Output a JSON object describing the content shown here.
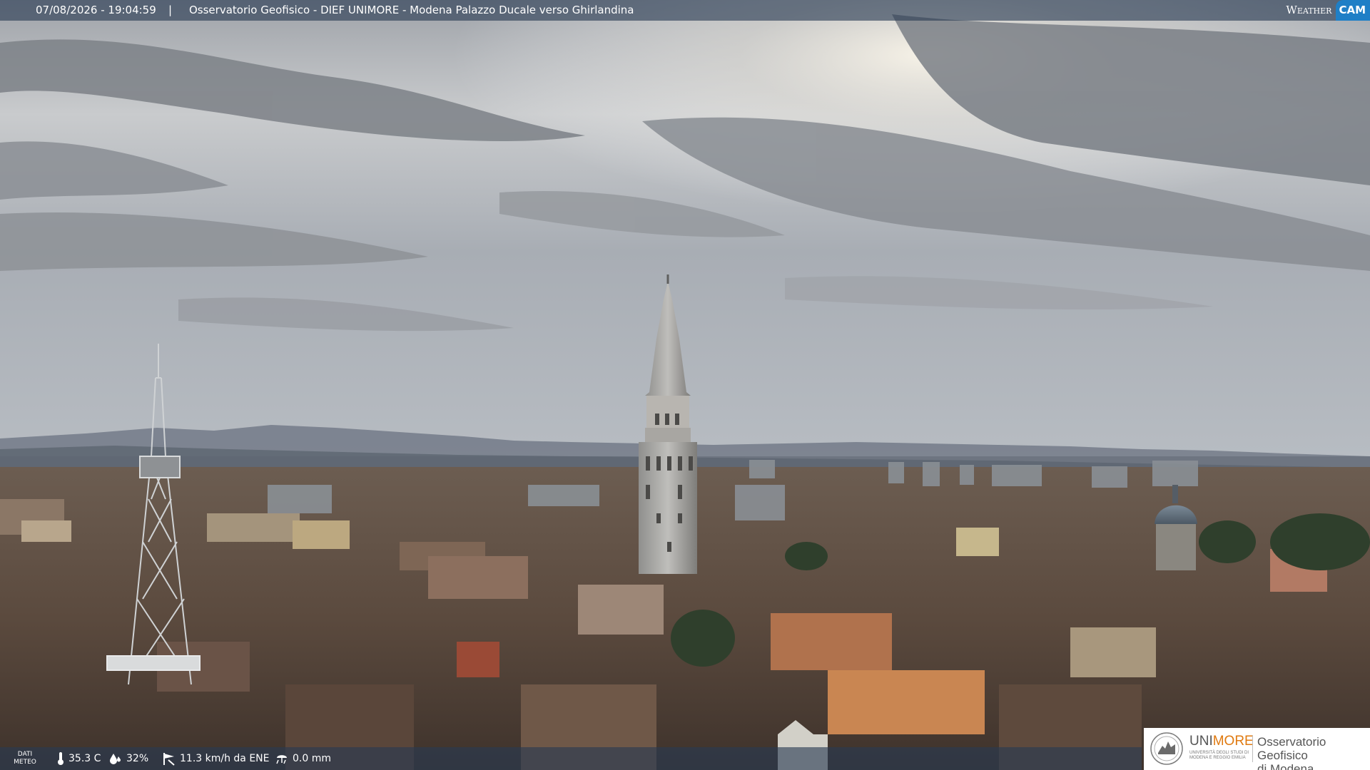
{
  "overlay": {
    "datetime": "07/08/2026 - 19:04:59",
    "separator": "|",
    "title": "Osservatorio Geofisico - DIEF UNIMORE - Modena Palazzo Ducale verso Ghirlandina",
    "brand_weather": "Weather",
    "brand_cam": "CAM"
  },
  "weather": {
    "label_line1": "DATI",
    "label_line2": "METEO",
    "temperature": "35.3 C",
    "humidity": "32%",
    "wind": "11.3 km/h da ENE",
    "rain": "0.0 mm",
    "icons": [
      "thermometer-icon",
      "humidity-drop-icon",
      "wind-icon",
      "rain-icon"
    ]
  },
  "logo": {
    "uni_prefix": "UNI",
    "uni_suffix": "MORE",
    "uni_small_line1": "UNIVERSITÀ DEGLI STUDI DI",
    "uni_small_line2": "MODENA E REGGIO EMILIA",
    "observatory_line1": "Osservatorio Geofisico",
    "observatory_line2": "di Modena"
  },
  "colors": {
    "overlay_bar": "#283a52",
    "brand_cam_bg": "#1f7fc6",
    "unimore_accent": "#e07a10"
  }
}
